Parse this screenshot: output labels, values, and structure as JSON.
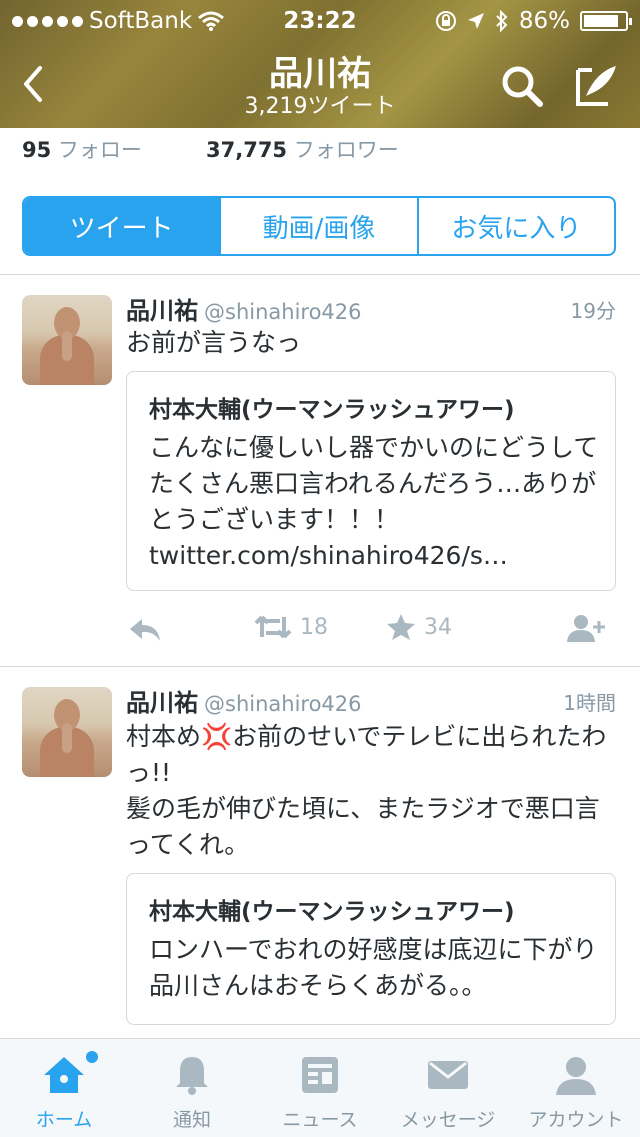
{
  "status_bar": {
    "carrier": "SoftBank",
    "time": "23:22",
    "battery": "86%",
    "battery_level": 0.86
  },
  "nav": {
    "title": "品川祐",
    "subtitle": "3,219ツイート"
  },
  "counts": {
    "following_num": "95",
    "following_label": "フォロー",
    "followers_num": "37,775",
    "followers_label": "フォロワー"
  },
  "tabs": [
    {
      "label": "ツイート",
      "active": true
    },
    {
      "label": "動画/画像",
      "active": false
    },
    {
      "label": "お気に入り",
      "active": false
    }
  ],
  "tweets": [
    {
      "name": "品川祐",
      "handle": "@shinahiro426",
      "time": "19分",
      "text": "お前が言うなっ",
      "card": {
        "title": "村本大輔(ウーマンラッシュアワー)",
        "text": "こんなに優しいし器でかいのにどうしてたくさん悪口言われるんだろう…ありがとうございます！！！ twitter.com/shinahiro426/s…"
      },
      "retweets": "18",
      "favorites": "34"
    },
    {
      "name": "品川祐",
      "handle": "@shinahiro426",
      "time": "1時間",
      "text_line1": "村本め💢お前のせいでテレビに出られたわっ!!",
      "text_line2": "髪の毛が伸びた頃に、またラジオで悪口言ってくれ。",
      "card": {
        "title": "村本大輔(ウーマンラッシュアワー)",
        "text": "ロンハーでおれの好感度は底辺に下がり品川さんはおそらくあがる。。"
      }
    }
  ],
  "bottom_nav": [
    {
      "label": "ホーム",
      "icon": "home-icon",
      "active": true
    },
    {
      "label": "通知",
      "icon": "bell-icon",
      "active": false
    },
    {
      "label": "ニュース",
      "icon": "news-icon",
      "active": false
    },
    {
      "label": "メッセージ",
      "icon": "envelope-icon",
      "active": false
    },
    {
      "label": "アカウント",
      "icon": "person-icon",
      "active": false
    }
  ],
  "colors": {
    "accent": "#2aa3ef",
    "muted": "#8899a6",
    "text": "#292f33",
    "icon_gray": "#aab8c2"
  }
}
